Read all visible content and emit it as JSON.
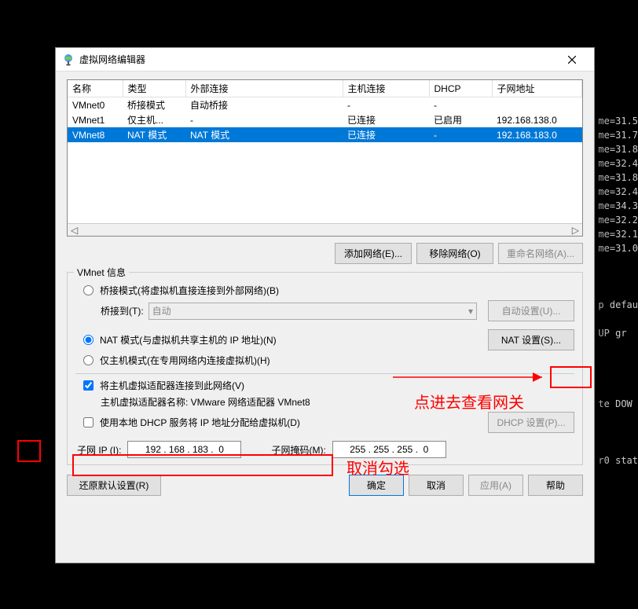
{
  "terminal_lines": [
    "me=31.5",
    "me=31.7",
    "me=31.8",
    "me=32.4",
    "me=31.8",
    "me=32.4",
    "me=34.3",
    "me=32.2",
    "me=32.1",
    "me=31.0",
    "",
    "",
    "",
    "p defau",
    "",
    "UP gr",
    "",
    "",
    "",
    "",
    "te DOW",
    "",
    "",
    "",
    "r0 stat",
    ""
  ],
  "titlebar": {
    "title": "虚拟网络编辑器"
  },
  "grid": {
    "headers": [
      "名称",
      "类型",
      "外部连接",
      "主机连接",
      "DHCP",
      "子网地址"
    ],
    "rows": [
      {
        "name": "VMnet0",
        "type": "桥接模式",
        "ext": "自动桥接",
        "host": "-",
        "dhcp": "-",
        "subnet": ""
      },
      {
        "name": "VMnet1",
        "type": "仅主机...",
        "ext": "-",
        "host": "已连接",
        "dhcp": "已启用",
        "subnet": "192.168.138.0"
      },
      {
        "name": "VMnet8",
        "type": "NAT 模式",
        "ext": "NAT 模式",
        "host": "已连接",
        "dhcp": "-",
        "subnet": "192.168.183.0",
        "selected": true
      }
    ]
  },
  "buttons": {
    "add_network": "添加网络(E)...",
    "remove_network": "移除网络(O)",
    "rename_network": "重命名网络(A)...",
    "auto_settings": "自动设置(U)...",
    "nat_settings": "NAT 设置(S)...",
    "dhcp_settings": "DHCP 设置(P)...",
    "restore_defaults": "还原默认设置(R)",
    "ok": "确定",
    "cancel": "取消",
    "apply": "应用(A)",
    "help": "帮助"
  },
  "group": {
    "title": "VMnet 信息",
    "bridge_mode": "桥接模式(将虚拟机直接连接到外部网络)(B)",
    "bridge_to_label": "桥接到(T):",
    "bridge_to_value": "自动",
    "nat_mode": "NAT 模式(与虚拟机共享主机的 IP 地址)(N)",
    "hostonly_mode": "仅主机模式(在专用网络内连接虚拟机)(H)",
    "connect_host_adapter": "将主机虚拟适配器连接到此网络(V)",
    "host_adapter_name": "主机虚拟适配器名称: VMware 网络适配器 VMnet8",
    "use_dhcp": "使用本地 DHCP 服务将 IP 地址分配给虚拟机(D)",
    "subnet_ip_label": "子网 IP (I):",
    "subnet_ip": "192 . 168 . 183 .  0",
    "subnet_mask_label": "子网掩码(M):",
    "subnet_mask": "255 . 255 . 255 .  0"
  },
  "annotations": {
    "view_gateway": "点进去查看网关",
    "uncheck": "取消勾选"
  }
}
